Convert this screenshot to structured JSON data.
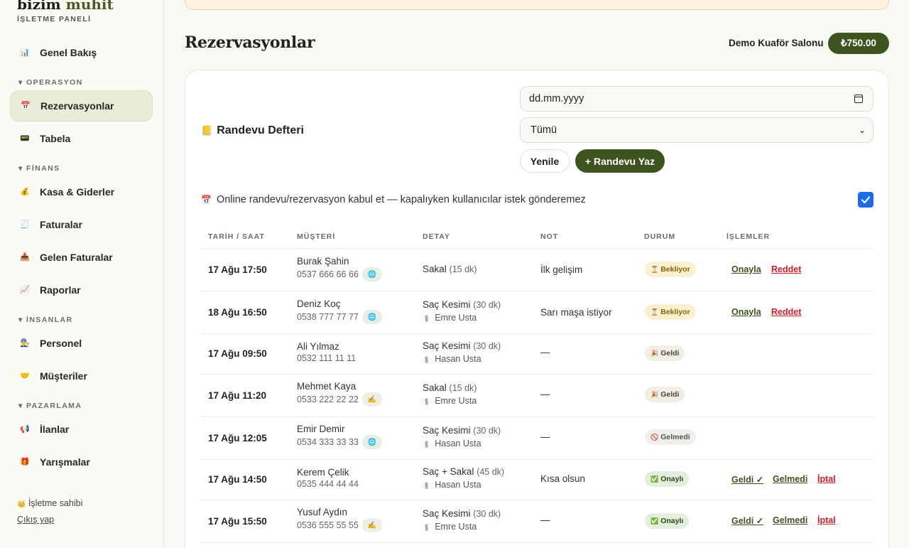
{
  "brand": {
    "name_1": "bizim",
    "name_2": "muhit",
    "subtitle": "İŞLETME PANELİ"
  },
  "sidebar": {
    "items": [
      {
        "icon": "chart-icon",
        "glyph": "📊",
        "label": "Genel Bakış"
      },
      {
        "icon": "calendar-icon",
        "glyph": "📅",
        "label": "Rezervasyonlar",
        "active": true
      },
      {
        "icon": "display-icon",
        "glyph": "📟",
        "label": "Tabela"
      },
      {
        "icon": "money-bag-icon",
        "glyph": "💰",
        "label": "Kasa & Giderler"
      },
      {
        "icon": "receipt-icon",
        "glyph": "🧾",
        "label": "Faturalar"
      },
      {
        "icon": "inbox-icon",
        "glyph": "📥",
        "label": "Gelen Faturalar"
      },
      {
        "icon": "trend-icon",
        "glyph": "📈",
        "label": "Raporlar"
      },
      {
        "icon": "people-icon",
        "glyph": "👨‍🔧",
        "label": "Personel"
      },
      {
        "icon": "handshake-icon",
        "glyph": "🤝",
        "label": "Müşteriler"
      },
      {
        "icon": "megaphone-icon",
        "glyph": "📢",
        "label": "İlanlar"
      },
      {
        "icon": "gift-icon",
        "glyph": "🎁",
        "label": "Yarışmalar"
      }
    ],
    "sections": [
      "OPERASYON",
      "FİNANS",
      "İNSANLAR",
      "PAZARLAMA"
    ],
    "owner": {
      "glyph": "👑",
      "label": "İşletme sahibi"
    },
    "logout": "Çıkış yap"
  },
  "header": {
    "title": "Rezervasyonlar",
    "salon": "Demo Kuaför Salonu",
    "balance": "₺750.00"
  },
  "toolbar": {
    "title": "Randevu Defteri",
    "title_glyph": "📒",
    "date_placeholder": "dd.mm.yyyy",
    "filter_value": "Tümü",
    "refresh_label": "Yenile",
    "new_label": "+ Randevu Yaz"
  },
  "online_toggle": {
    "glyph": "📅",
    "label": "Online randevu/rezervasyon kabul et — kapalıyken kullanıcılar istek gönderemez",
    "checked": true
  },
  "table": {
    "headers": [
      "TARİH / SAAT",
      "MÜŞTERİ",
      "DETAY",
      "NOT",
      "DURUM",
      "İŞLEMLER"
    ],
    "rows": [
      {
        "date": "17 Ağu 17:50",
        "name": "Burak Şahin",
        "phone": "0537 666 66 66",
        "source": "web",
        "source_glyph": "🌐",
        "service": "Sakal",
        "duration": "(15 dk)",
        "staff": "",
        "note": "İlk gelişim",
        "status": "Bekliyor",
        "status_glyph": "⏳",
        "status_type": "wait",
        "actions": [
          "Onayla",
          "Reddet"
        ]
      },
      {
        "date": "18 Ağu 16:50",
        "name": "Deniz Koç",
        "phone": "0538 777 77 77",
        "source": "web",
        "source_glyph": "🌐",
        "service": "Saç Kesimi",
        "duration": "(30 dk)",
        "staff": "Emre Usta",
        "note": "Sarı maşa istiyor",
        "status": "Bekliyor",
        "status_glyph": "⏳",
        "status_type": "wait",
        "actions": [
          "Onayla",
          "Reddet"
        ]
      },
      {
        "date": "17 Ağu 09:50",
        "name": "Ali Yılmaz",
        "phone": "0532 111 11 11",
        "source": "",
        "source_glyph": "",
        "service": "Saç Kesimi",
        "duration": "(30 dk)",
        "staff": "Hasan Usta",
        "note": "—",
        "status": "Geldi",
        "status_glyph": "🎉",
        "status_type": "came",
        "actions": []
      },
      {
        "date": "17 Ağu 11:20",
        "name": "Mehmet Kaya",
        "phone": "0533 222 22 22",
        "source": "manual",
        "source_glyph": "✍️",
        "service": "Sakal",
        "duration": "(15 dk)",
        "staff": "Emre Usta",
        "note": "—",
        "status": "Geldi",
        "status_glyph": "🎉",
        "status_type": "came",
        "actions": []
      },
      {
        "date": "17 Ağu 12:05",
        "name": "Emir Demir",
        "phone": "0534 333 33 33",
        "source": "web",
        "source_glyph": "🌐",
        "service": "Saç Kesimi",
        "duration": "(30 dk)",
        "staff": "Hasan Usta",
        "note": "—",
        "status": "Gelmedi",
        "status_glyph": "🚫",
        "status_type": "noshow",
        "actions": []
      },
      {
        "date": "17 Ağu 14:50",
        "name": "Kerem Çelik",
        "phone": "0535 444 44 44",
        "source": "",
        "source_glyph": "",
        "service": "Saç + Sakal",
        "duration": "(45 dk)",
        "staff": "Hasan Usta",
        "note": "Kısa olsun",
        "status": "Onaylı",
        "status_glyph": "✅",
        "status_type": "ok",
        "actions": [
          "Geldi ✓",
          "Gelmedi",
          "İptal"
        ]
      },
      {
        "date": "17 Ağu 15:50",
        "name": "Yusuf Aydın",
        "phone": "0536 555 55 55",
        "source": "manual",
        "source_glyph": "✍️",
        "service": "Saç Kesimi",
        "duration": "(30 dk)",
        "staff": "Emre Usta",
        "note": "—",
        "status": "Onaylı",
        "status_glyph": "✅",
        "status_type": "ok",
        "actions": [
          "Geldi ✓",
          "Gelmedi",
          "İptal"
        ]
      }
    ],
    "staff_glyph": "💈"
  },
  "colors": {
    "accent": "#3e5420",
    "danger": "#d11f2a",
    "checkbox": "#1a6ce8"
  }
}
